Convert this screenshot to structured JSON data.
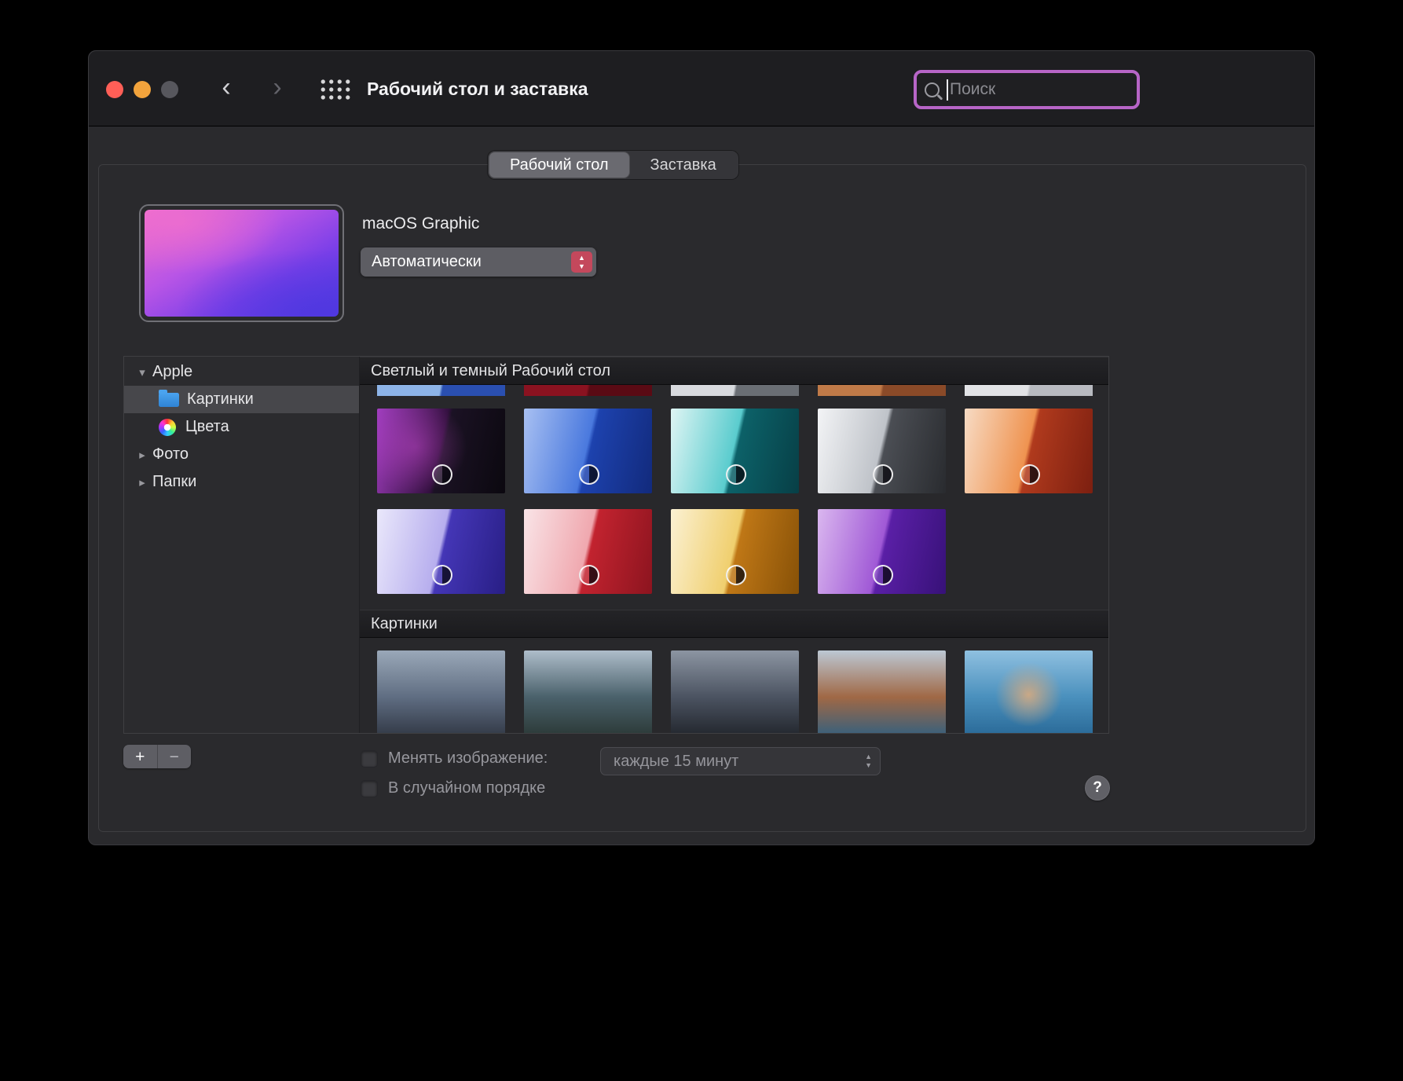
{
  "window": {
    "title": "Рабочий стол и заставка"
  },
  "toolbar": {
    "search_placeholder": "Поиск"
  },
  "icons": {
    "back": "‹",
    "forward": "›",
    "expand_down": "▾",
    "collapse_right": "▸",
    "chevron_up": "▲",
    "chevron_down": "▼"
  },
  "tabs": {
    "items": [
      {
        "id": "desktop",
        "label": "Рабочий стол",
        "selected": true
      },
      {
        "id": "screensaver",
        "label": "Заставка",
        "selected": false
      }
    ]
  },
  "preview": {
    "title": "macOS Graphic",
    "mode_select": "Автоматически",
    "colors": [
      "#ef6ece",
      "#b855e6",
      "#7a3fe8",
      "#4f38e0"
    ]
  },
  "sidebar": {
    "items": [
      {
        "id": "apple",
        "label": "Apple",
        "type": "group",
        "expanded": true
      },
      {
        "id": "pictures",
        "label": "Картинки",
        "type": "folder",
        "indent": true,
        "selected": true
      },
      {
        "id": "colors",
        "label": "Цвета",
        "type": "colors",
        "indent": true
      },
      {
        "id": "photos",
        "label": "Фото",
        "type": "group",
        "expanded": false
      },
      {
        "id": "folders",
        "label": "Папки",
        "type": "group",
        "expanded": false
      }
    ]
  },
  "gallery": {
    "sections": [
      {
        "title": "Светлый и темный Рабочий стол",
        "partial_row": [
          {
            "a": "#8db4e8",
            "b": "#2a4fb0"
          },
          {
            "a": "#8a1220",
            "b": "#5a0a14"
          },
          {
            "a": "#d8dade",
            "b": "#6a6e74"
          },
          {
            "a": "#c07a48",
            "b": "#8a4a28"
          },
          {
            "a": "#e2e3e6",
            "b": "#b8bac0"
          }
        ],
        "rows": [
          [
            {
              "l1": "#a23ec0",
              "l2": "#33103f",
              "d1": "#1b1224",
              "d2": "#0b080f",
              "glow": "#d44fd9",
              "badge": true
            },
            {
              "l1": "#a8c0f2",
              "l2": "#4a79de",
              "d1": "#1d42ae",
              "d2": "#122a7c",
              "badge": true
            },
            {
              "l1": "#dff5f4",
              "l2": "#5accce",
              "d1": "#0c6168",
              "d2": "#073f46",
              "badge": true
            },
            {
              "l1": "#f3f4f6",
              "l2": "#bfc3c9",
              "d1": "#4b4e54",
              "d2": "#292b2f",
              "badge": true
            },
            {
              "l1": "#f7dbc4",
              "l2": "#ef9350",
              "d1": "#b03a1d",
              "d2": "#7c1f10",
              "badge": true
            }
          ],
          [
            {
              "l1": "#eae8fb",
              "l2": "#b7aeee",
              "d1": "#4436b6",
              "d2": "#281e85",
              "badge": true
            },
            {
              "l1": "#f9e4e7",
              "l2": "#f0a8af",
              "d1": "#c2232f",
              "d2": "#8c141f",
              "badge": true
            },
            {
              "l1": "#fbf1d3",
              "l2": "#f0cf6e",
              "d1": "#bf7716",
              "d2": "#875107",
              "badge": true
            },
            {
              "l1": "#dab7ef",
              "l2": "#a059d6",
              "d1": "#5a1fa6",
              "d2": "#371178",
              "badge": true
            }
          ]
        ]
      },
      {
        "title": "Картинки",
        "photos": [
          {
            "stops": [
              "#9aa8b8",
              "#5f6d82",
              "#333a47"
            ]
          },
          {
            "stops": [
              "#aebdca",
              "#4a616b",
              "#2c3a38"
            ]
          },
          {
            "stops": [
              "#8c95a2",
              "#4b5361",
              "#23272e"
            ]
          },
          {
            "stops": [
              "#bcc8d4",
              "#a06845",
              "#38607c"
            ]
          },
          {
            "stops": [
              "#8fc0e0",
              "#4a90bd",
              "#2a6a98"
            ],
            "accent": "#c9a886"
          }
        ]
      }
    ]
  },
  "footer": {
    "add_label": "+",
    "remove_label": "−",
    "change_picture_label": "Менять изображение:",
    "change_picture_checked": false,
    "interval_value": "каждые 15 минут",
    "random_label": "В случайном порядке",
    "random_checked": false,
    "help_label": "?"
  },
  "colors": {
    "search_border": "#b765c7",
    "stepper": "#c4485c",
    "traffic_close": "#ff5f57",
    "traffic_min": "#f2a33c",
    "traffic_zoom": "#57575d",
    "folder_blue": "#4aa3ef"
  }
}
